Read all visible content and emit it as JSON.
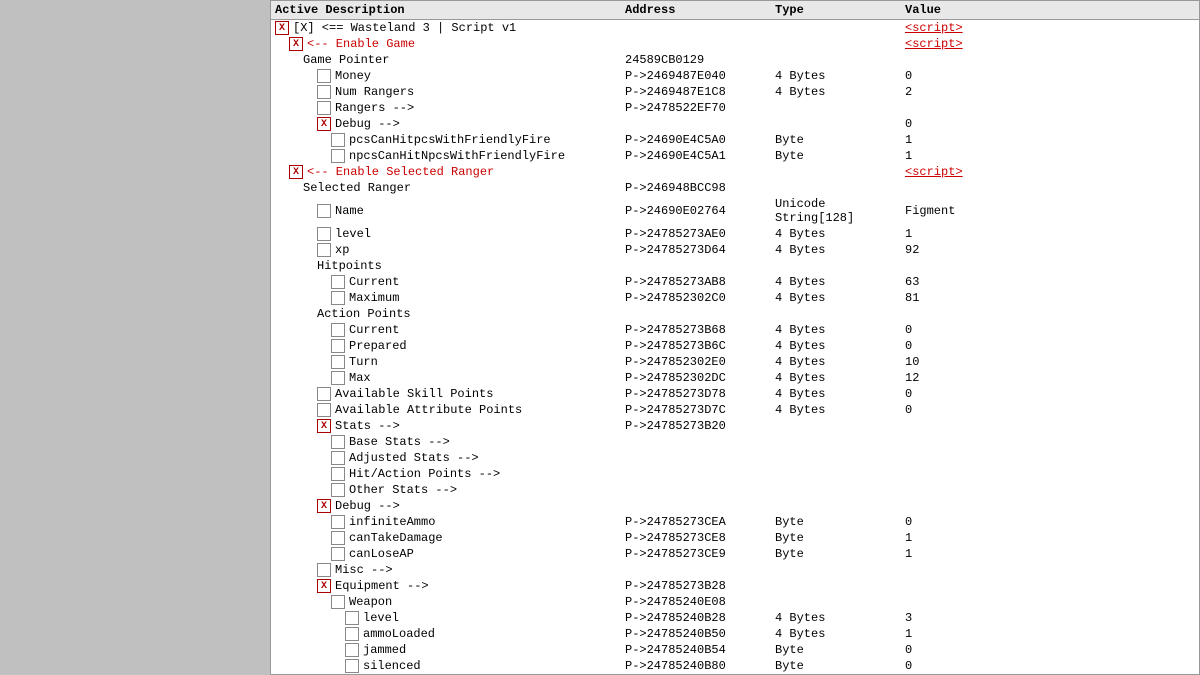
{
  "header": {
    "col_desc": "Active Description",
    "col_addr": "Address",
    "col_type": "Type",
    "col_val": "Value"
  },
  "rows": [
    {
      "id": "row-wasteland",
      "indent": 0,
      "checkbox": true,
      "checked": true,
      "label": "[X] <== Wasteland 3 | Script v1",
      "addr": "",
      "type": "",
      "value": "<script>",
      "label_class": "normal",
      "value_class": "script"
    },
    {
      "id": "row-enable-game",
      "indent": 1,
      "checkbox": true,
      "checked": true,
      "label": "<-- Enable Game",
      "addr": "",
      "type": "",
      "value": "<script>",
      "label_class": "red",
      "value_class": "script"
    },
    {
      "id": "row-game-pointer",
      "indent": 2,
      "checkbox": false,
      "checked": false,
      "label": "Game Pointer",
      "addr": "24589CB0129",
      "type": "",
      "value": "",
      "label_class": "normal",
      "value_class": "normal"
    },
    {
      "id": "row-money",
      "indent": 3,
      "checkbox": true,
      "checked": false,
      "label": "Money",
      "addr": "P->2469487E040",
      "type": "4 Bytes",
      "value": "0",
      "label_class": "normal",
      "value_class": "normal"
    },
    {
      "id": "row-num-rangers",
      "indent": 3,
      "checkbox": true,
      "checked": false,
      "label": "Num Rangers",
      "addr": "P->2469487E1C8",
      "type": "4 Bytes",
      "value": "2",
      "label_class": "normal",
      "value_class": "normal"
    },
    {
      "id": "row-rangers",
      "indent": 3,
      "checkbox": true,
      "checked": false,
      "label": "Rangers -->",
      "addr": "P->2478522EF70",
      "type": "",
      "value": "",
      "label_class": "normal",
      "value_class": "normal"
    },
    {
      "id": "row-debug1",
      "indent": 3,
      "checkbox": true,
      "checked": true,
      "label": "Debug -->",
      "addr": "",
      "type": "",
      "value": "0",
      "label_class": "normal",
      "value_class": "normal"
    },
    {
      "id": "row-pcs",
      "indent": 4,
      "checkbox": true,
      "checked": false,
      "label": "pcsCanHitpcsWithFriendlyFire",
      "addr": "P->24690E4C5A0",
      "type": "Byte",
      "value": "1",
      "label_class": "normal",
      "value_class": "normal"
    },
    {
      "id": "row-npcs",
      "indent": 4,
      "checkbox": true,
      "checked": false,
      "label": "npcsCanHitNpcsWithFriendlyFire",
      "addr": "P->24690E4C5A1",
      "type": "Byte",
      "value": "1",
      "label_class": "normal",
      "value_class": "normal"
    },
    {
      "id": "row-enable-selected",
      "indent": 1,
      "checkbox": true,
      "checked": true,
      "label": "<-- Enable Selected Ranger",
      "addr": "",
      "type": "",
      "value": "<script>",
      "label_class": "red",
      "value_class": "script"
    },
    {
      "id": "row-selected-ranger",
      "indent": 2,
      "checkbox": false,
      "checked": false,
      "label": "Selected Ranger",
      "addr": "P->246948BCC98",
      "type": "",
      "value": "",
      "label_class": "normal",
      "value_class": "normal"
    },
    {
      "id": "row-name",
      "indent": 3,
      "checkbox": true,
      "checked": false,
      "label": "Name",
      "addr": "P->24690E02764",
      "type": "Unicode String[128]",
      "value": "Figment",
      "label_class": "normal",
      "value_class": "normal"
    },
    {
      "id": "row-level",
      "indent": 3,
      "checkbox": true,
      "checked": false,
      "label": "level",
      "addr": "P->24785273AE0",
      "type": "4 Bytes",
      "value": "1",
      "label_class": "normal",
      "value_class": "normal"
    },
    {
      "id": "row-xp",
      "indent": 3,
      "checkbox": true,
      "checked": false,
      "label": "xp",
      "addr": "P->24785273D64",
      "type": "4 Bytes",
      "value": "92",
      "label_class": "normal",
      "value_class": "normal"
    },
    {
      "id": "row-hitpoints",
      "indent": 3,
      "checkbox": false,
      "checked": false,
      "label": "Hitpoints",
      "addr": "",
      "type": "",
      "value": "",
      "label_class": "normal",
      "value_class": "normal"
    },
    {
      "id": "row-current1",
      "indent": 4,
      "checkbox": true,
      "checked": false,
      "label": "Current",
      "addr": "P->24785273AB8",
      "type": "4 Bytes",
      "value": "63",
      "label_class": "normal",
      "value_class": "normal"
    },
    {
      "id": "row-maximum",
      "indent": 4,
      "checkbox": true,
      "checked": false,
      "label": "Maximum",
      "addr": "P->247852302C0",
      "type": "4 Bytes",
      "value": "81",
      "label_class": "normal",
      "value_class": "normal"
    },
    {
      "id": "row-action-points",
      "indent": 3,
      "checkbox": false,
      "checked": false,
      "label": "Action Points",
      "addr": "",
      "type": "",
      "value": "",
      "label_class": "normal",
      "value_class": "normal"
    },
    {
      "id": "row-current2",
      "indent": 4,
      "checkbox": true,
      "checked": false,
      "label": "Current",
      "addr": "P->24785273B68",
      "type": "4 Bytes",
      "value": "0",
      "label_class": "normal",
      "value_class": "normal"
    },
    {
      "id": "row-prepared",
      "indent": 4,
      "checkbox": true,
      "checked": false,
      "label": "Prepared",
      "addr": "P->24785273B6C",
      "type": "4 Bytes",
      "value": "0",
      "label_class": "normal",
      "value_class": "normal"
    },
    {
      "id": "row-turn",
      "indent": 4,
      "checkbox": true,
      "checked": false,
      "label": "Turn",
      "addr": "P->247852302E0",
      "type": "4 Bytes",
      "value": "10",
      "label_class": "normal",
      "value_class": "normal"
    },
    {
      "id": "row-max",
      "indent": 4,
      "checkbox": true,
      "checked": false,
      "label": "Max",
      "addr": "P->247852302DC",
      "type": "4 Bytes",
      "value": "12",
      "label_class": "normal",
      "value_class": "normal"
    },
    {
      "id": "row-avail-skill",
      "indent": 3,
      "checkbox": true,
      "checked": false,
      "label": "Available Skill Points",
      "addr": "P->24785273D78",
      "type": "4 Bytes",
      "value": "0",
      "label_class": "normal",
      "value_class": "normal"
    },
    {
      "id": "row-avail-attr",
      "indent": 3,
      "checkbox": true,
      "checked": false,
      "label": "Available Attribute Points",
      "addr": "P->24785273D7C",
      "type": "4 Bytes",
      "value": "0",
      "label_class": "normal",
      "value_class": "normal"
    },
    {
      "id": "row-stats",
      "indent": 3,
      "checkbox": true,
      "checked": true,
      "label": "Stats  -->",
      "addr": "P->24785273B20",
      "type": "",
      "value": "",
      "label_class": "normal",
      "value_class": "normal"
    },
    {
      "id": "row-base-stats",
      "indent": 4,
      "checkbox": true,
      "checked": false,
      "label": "Base Stats  -->",
      "addr": "",
      "type": "",
      "value": "",
      "label_class": "normal",
      "value_class": "normal"
    },
    {
      "id": "row-adj-stats",
      "indent": 4,
      "checkbox": true,
      "checked": false,
      "label": "Adjusted Stats  -->",
      "addr": "",
      "type": "",
      "value": "",
      "label_class": "normal",
      "value_class": "normal"
    },
    {
      "id": "row-hit-action",
      "indent": 4,
      "checkbox": true,
      "checked": false,
      "label": "Hit/Action Points  -->",
      "addr": "",
      "type": "",
      "value": "",
      "label_class": "normal",
      "value_class": "normal"
    },
    {
      "id": "row-other-stats",
      "indent": 4,
      "checkbox": true,
      "checked": false,
      "label": "Other Stats -->",
      "addr": "",
      "type": "",
      "value": "",
      "label_class": "normal",
      "value_class": "normal"
    },
    {
      "id": "row-debug2",
      "indent": 3,
      "checkbox": true,
      "checked": true,
      "label": "Debug -->",
      "addr": "",
      "type": "",
      "value": "",
      "label_class": "normal",
      "value_class": "normal"
    },
    {
      "id": "row-infinite-ammo",
      "indent": 4,
      "checkbox": true,
      "checked": false,
      "label": "infiniteAmmo",
      "addr": "P->24785273CEA",
      "type": "Byte",
      "value": "0",
      "label_class": "normal",
      "value_class": "normal"
    },
    {
      "id": "row-can-take-damage",
      "indent": 4,
      "checkbox": true,
      "checked": false,
      "label": "canTakeDamage",
      "addr": "P->24785273CE8",
      "type": "Byte",
      "value": "1",
      "label_class": "normal",
      "value_class": "normal"
    },
    {
      "id": "row-can-lose-ap",
      "indent": 4,
      "checkbox": true,
      "checked": false,
      "label": "canLoseAP",
      "addr": "P->24785273CE9",
      "type": "Byte",
      "value": "1",
      "label_class": "normal",
      "value_class": "normal"
    },
    {
      "id": "row-misc",
      "indent": 3,
      "checkbox": true,
      "checked": false,
      "label": "Misc -->",
      "addr": "",
      "type": "",
      "value": "",
      "label_class": "normal",
      "value_class": "normal"
    },
    {
      "id": "row-equipment",
      "indent": 3,
      "checkbox": true,
      "checked": true,
      "label": "Equipment -->",
      "addr": "P->24785273B28",
      "type": "",
      "value": "",
      "label_class": "normal",
      "value_class": "normal"
    },
    {
      "id": "row-weapon",
      "indent": 4,
      "checkbox": true,
      "checked": false,
      "label": "Weapon",
      "addr": "P->24785240E08",
      "type": "",
      "value": "",
      "label_class": "normal",
      "value_class": "normal"
    },
    {
      "id": "row-w-level",
      "indent": 5,
      "checkbox": true,
      "checked": false,
      "label": "level",
      "addr": "P->24785240B28",
      "type": "4 Bytes",
      "value": "3",
      "label_class": "normal",
      "value_class": "normal"
    },
    {
      "id": "row-ammo-loaded",
      "indent": 5,
      "checkbox": true,
      "checked": false,
      "label": "ammoLoaded",
      "addr": "P->24785240B50",
      "type": "4 Bytes",
      "value": "1",
      "label_class": "normal",
      "value_class": "normal"
    },
    {
      "id": "row-jammed",
      "indent": 5,
      "checkbox": true,
      "checked": false,
      "label": "jammed",
      "addr": "P->24785240B54",
      "type": "Byte",
      "value": "0",
      "label_class": "normal",
      "value_class": "normal"
    },
    {
      "id": "row-silenced",
      "indent": 5,
      "checkbox": true,
      "checked": false,
      "label": "silenced",
      "addr": "P->24785240B80",
      "type": "Byte",
      "value": "0",
      "label_class": "normal",
      "value_class": "normal"
    }
  ]
}
